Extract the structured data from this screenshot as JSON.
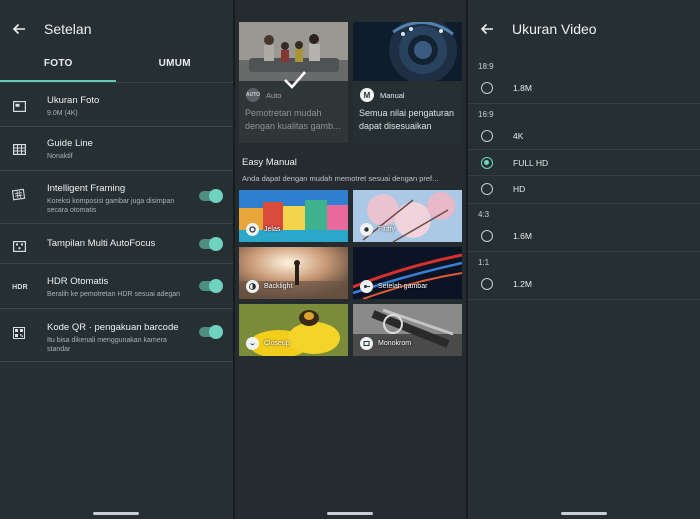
{
  "settings": {
    "title": "Setelan",
    "tabs": [
      "FOTO",
      "UMUM"
    ],
    "items": [
      {
        "title": "Ukuran Foto",
        "subtitle": "9.0M (4K)",
        "icon": "photo-size-icon",
        "toggle": false
      },
      {
        "title": "Guide Line",
        "subtitle": "Nonaktif",
        "icon": "grid-icon",
        "toggle": false
      },
      {
        "title": "Intelligent Framing",
        "subtitle": "Koreksi komposisi gambar juga disimpan secara otomatis",
        "icon": "framing-icon",
        "toggle": true
      },
      {
        "title": "Tampilan Multi AutoFocus",
        "subtitle": "",
        "icon": "autofocus-icon",
        "toggle": true
      },
      {
        "title": "HDR Otomatis",
        "subtitle": "Beralih ke pemotretan HDR sesuai adegan",
        "icon": "hdr-icon",
        "icon_text": "HDR",
        "toggle": true
      },
      {
        "title": "Kode QR · pengakuan barcode",
        "subtitle": "Itu bisa dikenali menggunakan kamera standar",
        "icon": "qr-code-icon",
        "toggle": true
      }
    ]
  },
  "modes": {
    "auto": {
      "badge": "AUTO",
      "name": "Auto",
      "desc": "Pemotretan mudah dengan kualitas gamb..."
    },
    "manual": {
      "badge": "M",
      "name": "Manual",
      "desc": "Semua nilai pengaturan dapat disesuaikan"
    },
    "easy_title": "Easy Manual",
    "easy_sub": "Anda dapat dengan mudah memotret sesuai dengan pref...",
    "scenes": [
      "Jelas",
      "Fluffy",
      "Backlight",
      "Setelah gambar",
      "Closeup",
      "Monokrom"
    ]
  },
  "video": {
    "title": "Ukuran Video",
    "groups": [
      {
        "label": "18:9",
        "options": [
          {
            "label": "1.8M",
            "selected": false
          }
        ]
      },
      {
        "label": "16:9",
        "options": [
          {
            "label": "4K",
            "selected": false
          },
          {
            "label": "FULL HD",
            "selected": true
          },
          {
            "label": "HD",
            "selected": false
          }
        ]
      },
      {
        "label": "4:3",
        "options": [
          {
            "label": "1.6M",
            "selected": false
          }
        ]
      },
      {
        "label": "1:1",
        "options": [
          {
            "label": "1.2M",
            "selected": false
          }
        ]
      }
    ]
  },
  "colors": {
    "accent": "#6fd3bf",
    "background": "#263033"
  }
}
